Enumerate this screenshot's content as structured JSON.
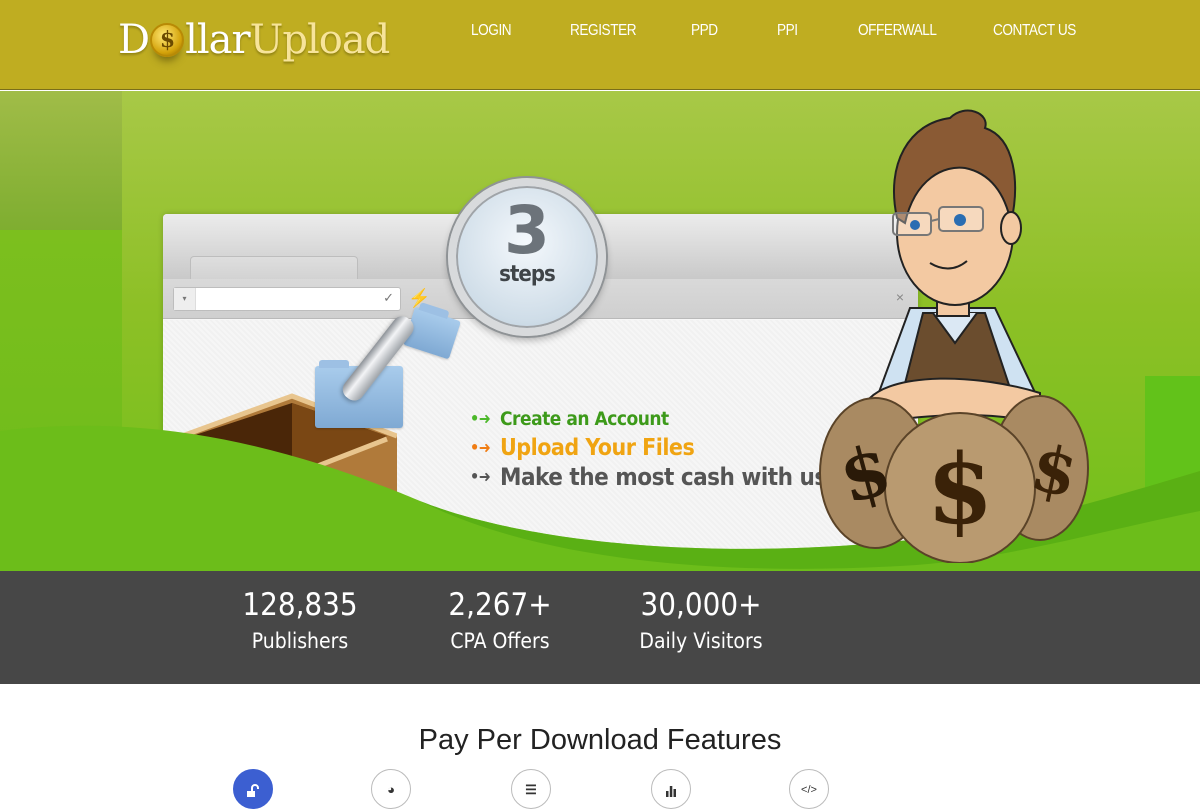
{
  "header": {
    "logo": {
      "part_a_1": "D",
      "coin_symbol": "$",
      "part_a_2": "llar",
      "part_b": "Upload"
    },
    "nav": [
      {
        "label": "LOGIN"
      },
      {
        "label": "REGISTER"
      },
      {
        "label": "PPD"
      },
      {
        "label": "PPI"
      },
      {
        "label": "OFFERWALL"
      },
      {
        "label": "CONTACT US"
      }
    ],
    "colors": {
      "background": "#bfad21"
    }
  },
  "hero": {
    "magnifier": {
      "number": "3",
      "label": "steps"
    },
    "browser": {
      "dropdown_icon": "▾",
      "check_icon": "✓",
      "close_icon": "×",
      "plug_icon": "⚡"
    },
    "steps": [
      {
        "arrow": "•➜",
        "text": "Create an Account",
        "color": "#3d9a1a"
      },
      {
        "arrow": "•➜",
        "text": "Upload Your Files",
        "color": "#f0a412"
      },
      {
        "arrow": "•➜",
        "text": "Make the most cash with us",
        "color": "#555555"
      }
    ]
  },
  "stats": [
    {
      "value": "128,835",
      "label": "Publishers"
    },
    {
      "value": "2,267+",
      "label": "CPA Offers"
    },
    {
      "value": "30,000+",
      "label": "Daily Visitors"
    }
  ],
  "features": {
    "title": "Pay Per Download Features",
    "icons": [
      {
        "name": "unlock-icon",
        "glyph": "🔓︎",
        "active": true
      },
      {
        "name": "dashboard-icon",
        "glyph": "◕",
        "active": false
      },
      {
        "name": "list-icon",
        "glyph": "☰",
        "active": false
      },
      {
        "name": "bar-chart-icon",
        "glyph": "▮",
        "active": false
      },
      {
        "name": "code-icon",
        "glyph": "</>",
        "active": false
      }
    ],
    "active_color": "#3c5fd1"
  }
}
